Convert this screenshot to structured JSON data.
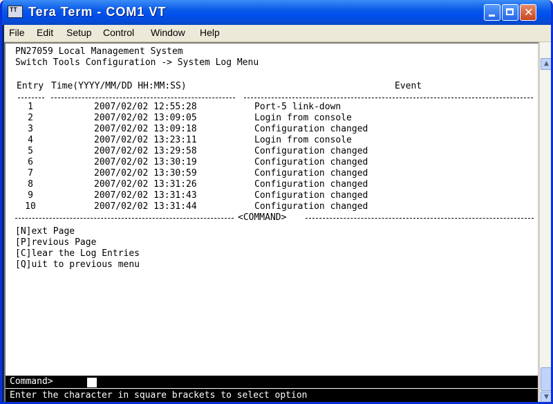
{
  "window": {
    "title": "Tera Term - COM1 VT"
  },
  "menu": {
    "items": [
      {
        "label": "File"
      },
      {
        "label": "Edit"
      },
      {
        "label": "Setup"
      },
      {
        "label": "Control"
      },
      {
        "label": "Window"
      },
      {
        "label": "Help"
      }
    ]
  },
  "terminal": {
    "system_name": "PN27059 Local Management System",
    "breadcrumb": "Switch Tools Configuration -> System Log Menu",
    "headers": {
      "entry": "Entry",
      "time": "Time(YYYY/MM/DD HH:MM:SS)",
      "event": "Event"
    },
    "rows": [
      {
        "entry": "1",
        "time": "2007/02/02 12:55:28",
        "event": "Port-5 link-down"
      },
      {
        "entry": "2",
        "time": "2007/02/02 13:09:05",
        "event": "Login from console"
      },
      {
        "entry": "3",
        "time": "2007/02/02 13:09:18",
        "event": "Configuration changed"
      },
      {
        "entry": "4",
        "time": "2007/02/02 13:23:11",
        "event": "Login from console"
      },
      {
        "entry": "5",
        "time": "2007/02/02 13:29:58",
        "event": "Configuration changed"
      },
      {
        "entry": "6",
        "time": "2007/02/02 13:30:19",
        "event": "Configuration changed"
      },
      {
        "entry": "7",
        "time": "2007/02/02 13:30:59",
        "event": "Configuration changed"
      },
      {
        "entry": "8",
        "time": "2007/02/02 13:31:26",
        "event": "Configuration changed"
      },
      {
        "entry": "9",
        "time": "2007/02/02 13:31:43",
        "event": "Configuration changed"
      },
      {
        "entry": "10",
        "time": "2007/02/02 13:31:44",
        "event": "Configuration changed"
      }
    ],
    "command_divider": "<COMMAND>",
    "commands": [
      "[N]ext Page",
      "[P]revious Page",
      "[C]lear the Log Entries",
      "[Q]uit to previous menu"
    ],
    "prompt": "Command>",
    "command_value": "",
    "status": "Enter the character in square brackets to select option"
  },
  "colors": {
    "titlebar": "#0a5ae8",
    "terminal_bg": "#ffffff",
    "terminal_fg": "#000000"
  }
}
